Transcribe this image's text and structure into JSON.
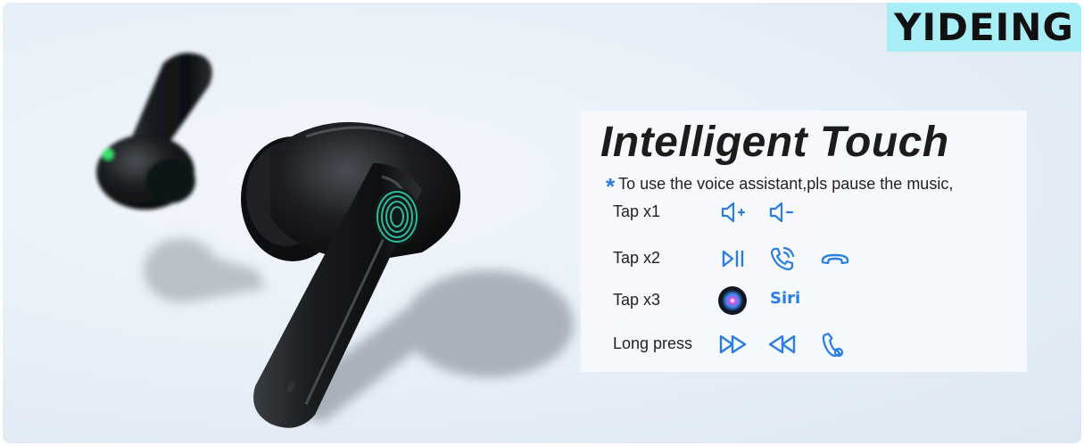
{
  "brand": {
    "name": "YIDEING",
    "bg_color": "#a8eef7"
  },
  "panel": {
    "title": "Intelligent Touch",
    "note": "To use the voice assistant,pls pause the music,",
    "accent_color": "#2a7de1",
    "rows": [
      {
        "label": "Tap x1",
        "icons": [
          "volume-up-icon",
          "volume-down-icon"
        ]
      },
      {
        "label": "Tap x2",
        "icons": [
          "play-pause-icon",
          "answer-call-icon",
          "hang-up-icon"
        ]
      },
      {
        "label": "Tap x3",
        "icons": [
          "siri-icon"
        ],
        "text": "Siri"
      },
      {
        "label": "Long press",
        "icons": [
          "next-track-icon",
          "previous-track-icon",
          "reject-call-icon"
        ]
      }
    ]
  }
}
